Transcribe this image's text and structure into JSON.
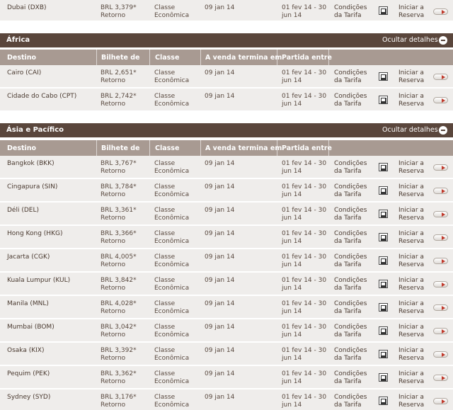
{
  "columns": {
    "destination": "Destino",
    "fare": "Bilhete de",
    "class": "Classe",
    "sale_ends": "A venda termina em",
    "departure": "Partida entre"
  },
  "top_row": {
    "destination": "Dubai (DXB)",
    "price": "BRL 3,379*",
    "trip": "Retorno",
    "class_l1": "Classe",
    "class_l2": "Econômica",
    "sale_end": "09 jan 14",
    "dep_l1": "01 fev 14 - 30",
    "dep_l2": "jun 14",
    "cond_l1": "Condições",
    "cond_l2": "da Tarifa",
    "book_l1": "Iniciar a",
    "book_l2": "Reserva"
  },
  "africa": {
    "title": "África",
    "toggle": "Ocultar detalhes",
    "rows": [
      {
        "destination": "Cairo (CAI)",
        "price": "BRL 2,651*",
        "trip": "Retorno",
        "class_l1": "Classe",
        "class_l2": "Econômica",
        "sale_end": "09 jan 14",
        "dep_l1": "01 fev 14 - 30",
        "dep_l2": "jun 14",
        "cond_l1": "Condições",
        "cond_l2": "da Tarifa",
        "book_l1": "Iniciar a",
        "book_l2": "Reserva"
      },
      {
        "destination": "Cidade do Cabo (CPT)",
        "price": "BRL 2,742*",
        "trip": "Retorno",
        "class_l1": "Classe",
        "class_l2": "Econômica",
        "sale_end": "09 jan 14",
        "dep_l1": "01 fev 14 - 30",
        "dep_l2": "jun 14",
        "cond_l1": "Condições",
        "cond_l2": "da Tarifa",
        "book_l1": "Iniciar a",
        "book_l2": "Reserva"
      }
    ]
  },
  "asia": {
    "title": "Ásia e Pacífico",
    "toggle": "Ocultar detalhes",
    "rows": [
      {
        "destination": "Bangkok (BKK)",
        "price": "BRL 3,767*",
        "trip": "Retorno",
        "class_l1": "Classe",
        "class_l2": "Econômica",
        "sale_end": "09 jan 14",
        "dep_l1": "01 fev 14 - 30",
        "dep_l2": "jun 14",
        "cond_l1": "Condições",
        "cond_l2": "da Tarifa",
        "book_l1": "Iniciar a",
        "book_l2": "Reserva"
      },
      {
        "destination": "Cingapura (SIN)",
        "price": "BRL 3,784*",
        "trip": "Retorno",
        "class_l1": "Classe",
        "class_l2": "Econômica",
        "sale_end": "09 jan 14",
        "dep_l1": "01 fev 14 - 30",
        "dep_l2": "jun 14",
        "cond_l1": "Condições",
        "cond_l2": "da Tarifa",
        "book_l1": "Iniciar a",
        "book_l2": "Reserva"
      },
      {
        "destination": "Déli (DEL)",
        "price": "BRL 3,361*",
        "trip": "Retorno",
        "class_l1": "Classe",
        "class_l2": "Econômica",
        "sale_end": "09 jan 14",
        "dep_l1": "01 fev 14 - 30",
        "dep_l2": "jun 14",
        "cond_l1": "Condições",
        "cond_l2": "da Tarifa",
        "book_l1": "Iniciar a",
        "book_l2": "Reserva"
      },
      {
        "destination": "Hong Kong (HKG)",
        "price": "BRL 3,366*",
        "trip": "Retorno",
        "class_l1": "Classe",
        "class_l2": "Econômica",
        "sale_end": "09 jan 14",
        "dep_l1": "01 fev 14 - 30",
        "dep_l2": "jun 14",
        "cond_l1": "Condições",
        "cond_l2": "da Tarifa",
        "book_l1": "Iniciar a",
        "book_l2": "Reserva"
      },
      {
        "destination": "Jacarta (CGK)",
        "price": "BRL 4,005*",
        "trip": "Retorno",
        "class_l1": "Classe",
        "class_l2": "Econômica",
        "sale_end": "09 jan 14",
        "dep_l1": "01 fev 14 - 30",
        "dep_l2": "jun 14",
        "cond_l1": "Condições",
        "cond_l2": "da Tarifa",
        "book_l1": "Iniciar a",
        "book_l2": "Reserva"
      },
      {
        "destination": "Kuala Lumpur (KUL)",
        "price": "BRL 3,842*",
        "trip": "Retorno",
        "class_l1": "Classe",
        "class_l2": "Econômica",
        "sale_end": "09 jan 14",
        "dep_l1": "01 fev 14 - 30",
        "dep_l2": "jun 14",
        "cond_l1": "Condições",
        "cond_l2": "da Tarifa",
        "book_l1": "Iniciar a",
        "book_l2": "Reserva"
      },
      {
        "destination": "Manila (MNL)",
        "price": "BRL 4,028*",
        "trip": "Retorno",
        "class_l1": "Classe",
        "class_l2": "Econômica",
        "sale_end": "09 jan 14",
        "dep_l1": "01 fev 14 - 30",
        "dep_l2": "jun 14",
        "cond_l1": "Condições",
        "cond_l2": "da Tarifa",
        "book_l1": "Iniciar a",
        "book_l2": "Reserva"
      },
      {
        "destination": "Mumbai (BOM)",
        "price": "BRL 3,042*",
        "trip": "Retorno",
        "class_l1": "Classe",
        "class_l2": "Econômica",
        "sale_end": "09 jan 14",
        "dep_l1": "01 fev 14 - 30",
        "dep_l2": "jun 14",
        "cond_l1": "Condições",
        "cond_l2": "da Tarifa",
        "book_l1": "Iniciar a",
        "book_l2": "Reserva"
      },
      {
        "destination": "Osaka (KIX)",
        "price": "BRL 3,392*",
        "trip": "Retorno",
        "class_l1": "Classe",
        "class_l2": "Econômica",
        "sale_end": "09 jan 14",
        "dep_l1": "01 fev 14 - 30",
        "dep_l2": "jun 14",
        "cond_l1": "Condições",
        "cond_l2": "da Tarifa",
        "book_l1": "Iniciar a",
        "book_l2": "Reserva"
      },
      {
        "destination": "Pequim (PEK)",
        "price": "BRL 3,362*",
        "trip": "Retorno",
        "class_l1": "Classe",
        "class_l2": "Econômica",
        "sale_end": "09 jan 14",
        "dep_l1": "01 fev 14 - 30",
        "dep_l2": "jun 14",
        "cond_l1": "Condições",
        "cond_l2": "da Tarifa",
        "book_l1": "Iniciar a",
        "book_l2": "Reserva"
      },
      {
        "destination": "Sydney (SYD)",
        "price": "BRL 3,176*",
        "trip": "Retorno",
        "class_l1": "Classe",
        "class_l2": "Econômica",
        "sale_end": "09 jan 14",
        "dep_l1": "01 fev 14 - 30",
        "dep_l2": "jun 14",
        "cond_l1": "Condições",
        "cond_l2": "da Tarifa",
        "book_l1": "Iniciar a",
        "book_l2": "Reserva"
      }
    ]
  }
}
